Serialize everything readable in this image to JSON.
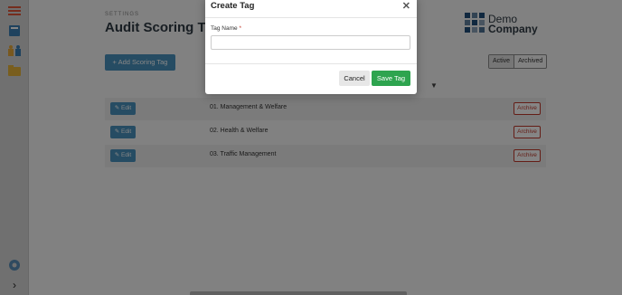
{
  "sidebar": {
    "items": [
      {
        "icon": "list-icon"
      },
      {
        "icon": "book-icon"
      },
      {
        "icon": "team-icon"
      },
      {
        "icon": "folder-icon"
      }
    ],
    "settings_icon": "gear-icon",
    "expand_icon": "chevron-right-icon",
    "expand_glyph": "›"
  },
  "header": {
    "section_label": "SETTINGS",
    "title": "Audit Scoring Tags"
  },
  "logo": {
    "line1": "Demo",
    "line2": "Company"
  },
  "toolbar": {
    "add_label": "+ Add Scoring Tag",
    "segments": {
      "active": "Active",
      "archived": "Archived",
      "selected": "Active"
    },
    "filter_glyph": "▼"
  },
  "table": {
    "edit_label": "✎ Edit",
    "archive_label": "Archive",
    "rows": [
      {
        "name": "01. Management & Welfare"
      },
      {
        "name": "02. Health & Welfare"
      },
      {
        "name": "03. Traffic Management"
      }
    ]
  },
  "modal": {
    "title": "Create Tag",
    "close_glyph": "✕",
    "field_label": "Tag Name",
    "required_mark": "*",
    "field_value": "",
    "field_placeholder": "",
    "cancel_label": "Cancel",
    "save_label": "Save Tag"
  },
  "colors": {
    "primary": "#4a93bf",
    "success": "#2ea44f",
    "danger": "#c0392b",
    "logo": "#1f4e79"
  }
}
